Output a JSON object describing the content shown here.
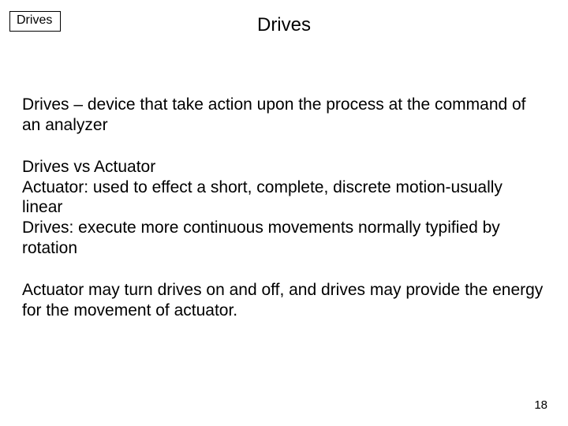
{
  "header": {
    "topic_box": "Drives",
    "title": "Drives"
  },
  "body": {
    "p1": "Drives – device that take action upon the process at the command of an analyzer",
    "p2_l1": "Drives vs Actuator",
    "p2_l2": "Actuator: used to effect a short, complete, discrete motion-usually linear",
    "p2_l3": "Drives: execute more continuous movements normally typified by rotation",
    "p3": "Actuator may turn drives on and off, and drives may provide the energy for the movement of actuator."
  },
  "footer": {
    "page_number": "18"
  }
}
